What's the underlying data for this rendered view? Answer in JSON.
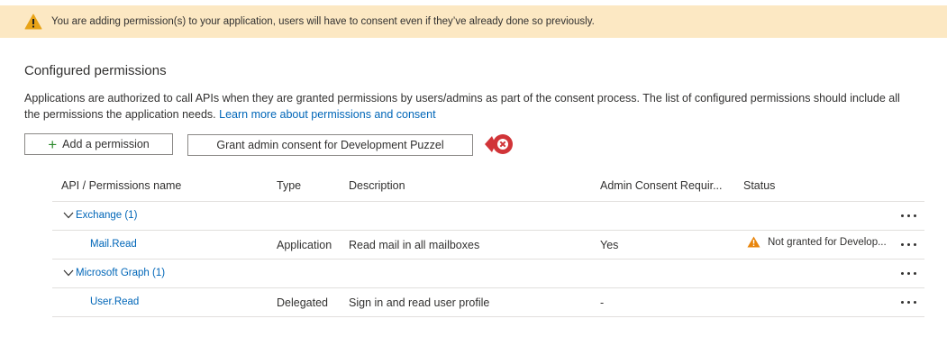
{
  "banner": {
    "text": "You are adding permission(s) to your application, users will have to consent even if they’ve already done so previously."
  },
  "section": {
    "title": "Configured permissions",
    "description": "Applications are authorized to call APIs when they are granted permissions by users/admins as part of the consent process. The list of configured permissions should include all the permissions the application needs.",
    "learn_more": "Learn more about permissions and consent"
  },
  "toolbar": {
    "add_label": "Add a permission",
    "grant_label": "Grant admin consent for Development Puzzel"
  },
  "table": {
    "headers": {
      "name": "API / Permissions name",
      "type": "Type",
      "description": "Description",
      "admin": "Admin Consent Requir...",
      "status": "Status"
    },
    "groups": [
      {
        "label": "Exchange (1)",
        "rows": [
          {
            "name": "Mail.Read",
            "type": "Application",
            "description": "Read mail in all mailboxes",
            "admin": "Yes",
            "status": "Not granted for Develop..."
          }
        ]
      },
      {
        "label": "Microsoft Graph (1)",
        "rows": [
          {
            "name": "User.Read",
            "type": "Delegated",
            "description": "Sign in and read user profile",
            "admin": "-",
            "status": ""
          }
        ]
      }
    ]
  },
  "colors": {
    "banner_bg": "#fce8c3",
    "warning": "#e8850c",
    "link": "#0066b8",
    "error": "#d13438"
  },
  "icons": {
    "banner": "warning-icon",
    "add": "plus-icon",
    "error": "error-badge-icon",
    "expand": "chevron-down-icon",
    "more": "more-icon",
    "status": "warning-icon"
  }
}
